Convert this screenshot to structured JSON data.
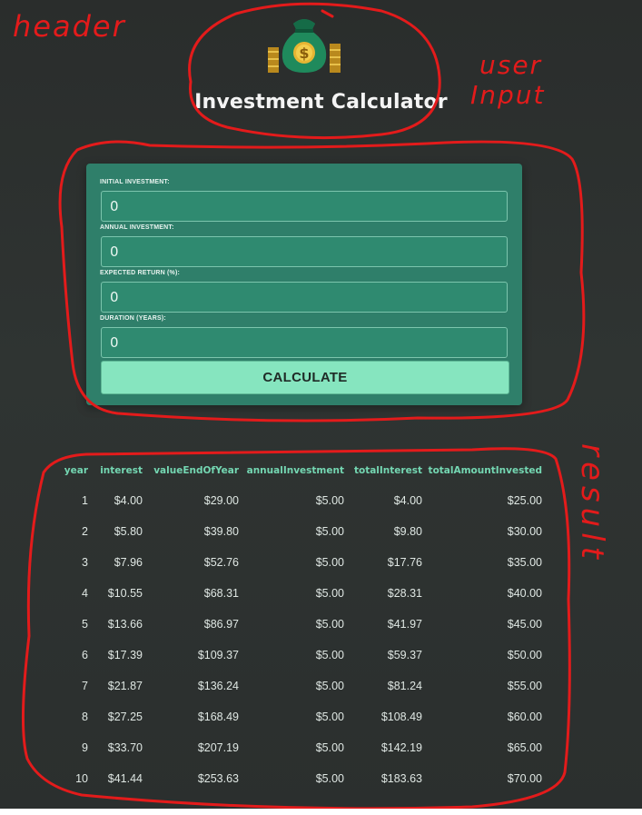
{
  "header": {
    "title": "Investment Calculator"
  },
  "form": {
    "fields": [
      {
        "label": "INITIAL INVESTMENT:",
        "value": "0"
      },
      {
        "label": "ANNUAL INVESTMENT:",
        "value": "0"
      },
      {
        "label": "EXPECTED RETURN (%):",
        "value": "0"
      },
      {
        "label": "DURATION (YEARS):",
        "value": "0"
      }
    ],
    "calculate_label": "CALCULATE"
  },
  "results": {
    "headers": [
      "year",
      "interest",
      "valueEndOfYear",
      "annualInvestment",
      "totalInterest",
      "totalAmountInvested"
    ],
    "rows": [
      [
        "1",
        "$4.00",
        "$29.00",
        "$5.00",
        "$4.00",
        "$25.00"
      ],
      [
        "2",
        "$5.80",
        "$39.80",
        "$5.00",
        "$9.80",
        "$30.00"
      ],
      [
        "3",
        "$7.96",
        "$52.76",
        "$5.00",
        "$17.76",
        "$35.00"
      ],
      [
        "4",
        "$10.55",
        "$68.31",
        "$5.00",
        "$28.31",
        "$40.00"
      ],
      [
        "5",
        "$13.66",
        "$86.97",
        "$5.00",
        "$41.97",
        "$45.00"
      ],
      [
        "6",
        "$17.39",
        "$109.37",
        "$5.00",
        "$59.37",
        "$50.00"
      ],
      [
        "7",
        "$21.87",
        "$136.24",
        "$5.00",
        "$81.24",
        "$55.00"
      ],
      [
        "8",
        "$27.25",
        "$168.49",
        "$5.00",
        "$108.49",
        "$60.00"
      ],
      [
        "9",
        "$33.70",
        "$207.19",
        "$5.00",
        "$142.19",
        "$65.00"
      ],
      [
        "10",
        "$41.44",
        "$253.63",
        "$5.00",
        "$183.63",
        "$70.00"
      ]
    ]
  },
  "annotations": {
    "header": "header",
    "user_input_1": "user",
    "user_input_2": "Input",
    "result": "result"
  },
  "colors": {
    "background": "#2d312f",
    "card": "#2f7f6a",
    "input": "#2f8a70",
    "button": "#86e5bf",
    "header_text": "#74d7b2",
    "annotation": "#e31b1b"
  },
  "icons": {
    "logo": "money-bag-icon"
  }
}
